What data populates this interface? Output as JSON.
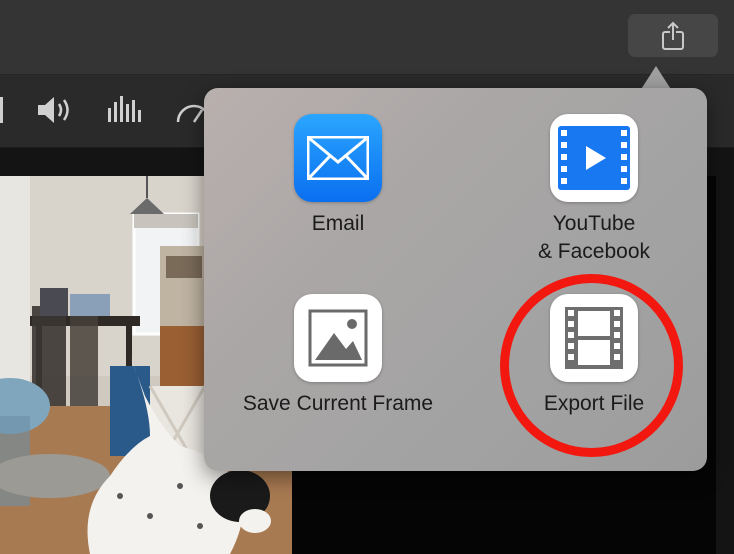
{
  "toolbar": {
    "share_icon": "share-icon"
  },
  "viewer_controls": {
    "icons": [
      "volume-icon",
      "audio-equalizer-icon",
      "speed-icon"
    ]
  },
  "share_menu": {
    "options": [
      {
        "label": "Email",
        "icon": "email-envelope-icon"
      },
      {
        "label": "YouTube\n& Facebook",
        "icon": "youtube-facebook-video-icon"
      },
      {
        "label": "Save Current Frame",
        "icon": "image-frame-icon"
      },
      {
        "label": "Export File",
        "icon": "film-strip-icon"
      }
    ],
    "highlighted_option": "Export File",
    "highlight_color": "#f2180f"
  },
  "colors": {
    "email_gradient_top": "#2aa6ff",
    "email_gradient_bottom": "#0a6ff0",
    "youtube_blue": "#1778f2"
  }
}
